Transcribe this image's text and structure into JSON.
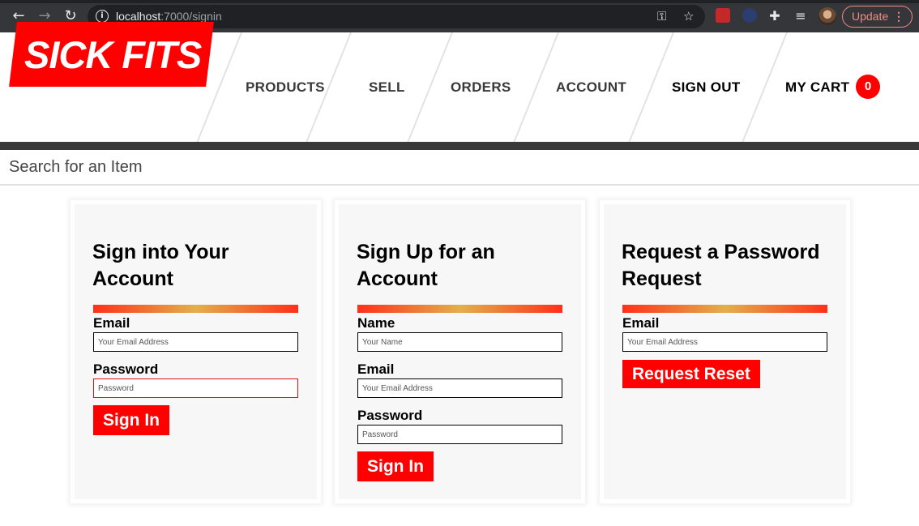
{
  "browser": {
    "url_host": "localhost",
    "url_path": ":7000/signin",
    "update_label": "Update"
  },
  "header": {
    "logo": "SICK FITS",
    "nav": [
      "PRODUCTS",
      "SELL",
      "ORDERS",
      "ACCOUNT",
      "SIGN OUT",
      "MY CART"
    ],
    "cart_count": "0"
  },
  "search": {
    "placeholder": "Search for an Item"
  },
  "signin": {
    "title": "Sign into Your Account",
    "email_label": "Email",
    "email_placeholder": "Your Email Address",
    "password_label": "Password",
    "password_placeholder": "Password",
    "button": "Sign In"
  },
  "signup": {
    "title": "Sign Up for an Account",
    "name_label": "Name",
    "name_placeholder": "Your Name",
    "email_label": "Email",
    "email_placeholder": "Your Email Address",
    "password_label": "Password",
    "password_placeholder": "Password",
    "button": "Sign In"
  },
  "reset": {
    "title": "Request a Password Request",
    "email_label": "Email",
    "email_placeholder": "Your Email Address",
    "button": "Request Reset"
  },
  "colors": {
    "brand_red": "#ff0000",
    "dark": "#393939"
  }
}
